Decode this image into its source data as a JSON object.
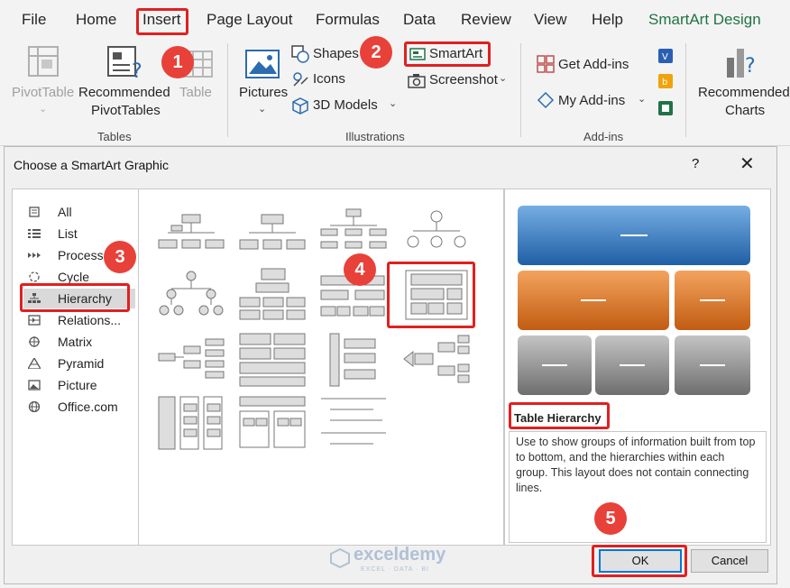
{
  "menu": {
    "tabs": [
      "File",
      "Home",
      "Insert",
      "Page Layout",
      "Formulas",
      "Data",
      "Review",
      "View",
      "Help",
      "SmartArt Design"
    ]
  },
  "ribbon": {
    "tables": {
      "pivottable": "PivotTable",
      "recommended_pivottables_1": "Recommended",
      "recommended_pivottables_2": "PivotTables",
      "table": "Table",
      "group": "Tables"
    },
    "illustrations": {
      "pictures": "Pictures",
      "shapes": "Shapes",
      "icons": "Icons",
      "models_3d": "3D Models",
      "smartart": "SmartArt",
      "screenshot": "Screenshot",
      "group": "Illustrations"
    },
    "addins": {
      "get_addins": "Get Add-ins",
      "my_addins": "My Add-ins",
      "group": "Add-ins"
    },
    "charts": {
      "recommended_charts_1": "Recommended",
      "recommended_charts_2": "Charts"
    }
  },
  "dialog": {
    "title": "Choose a SmartArt Graphic",
    "help": "?",
    "close": "✕",
    "categories": [
      "All",
      "List",
      "Process",
      "Cycle",
      "Hierarchy",
      "Relations...",
      "Matrix",
      "Pyramid",
      "Picture",
      "Office.com"
    ],
    "selected_category": "Hierarchy",
    "preview": {
      "title": "Table Hierarchy",
      "description": "Use to show groups of information built from top to bottom, and the hierarchies within each group. This layout does not contain connecting lines."
    },
    "ok_label": "OK",
    "cancel_label": "Cancel"
  },
  "steps": [
    "1",
    "2",
    "3",
    "4",
    "5"
  ],
  "watermark": {
    "name": "exceldemy",
    "tagline": "EXCEL · DATA · BI"
  },
  "colors": {
    "highlight": "#e02020",
    "badge": "#e8413a",
    "smartart_design_tab": "#217346",
    "preview_blue": "#2e75b6",
    "preview_orange": "#d46d1b",
    "preview_gray": "#8a8a8a"
  }
}
